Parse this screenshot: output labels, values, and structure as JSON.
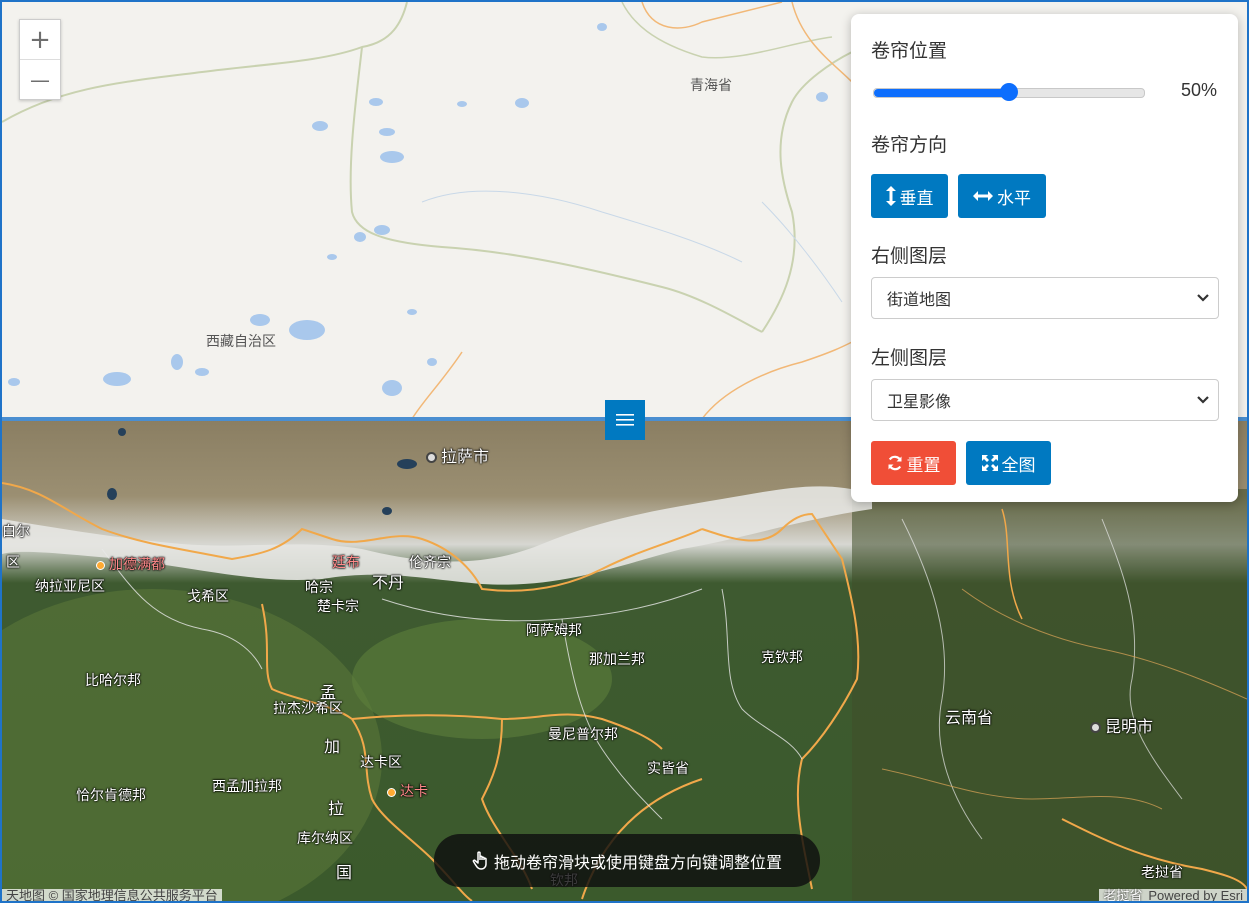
{
  "top_map": {
    "labels": {
      "qinghai": "青海省",
      "xizang": "西藏自治区"
    }
  },
  "bottom_map": {
    "labels": {
      "lhasa": "拉萨市",
      "kathmandu": "加德满都",
      "thimphu": "廷布",
      "bhutan": "不丹",
      "lhuntse": "伦齐宗",
      "haa": "哈宗",
      "chukha": "楚卡宗",
      "narayani": "纳拉亚尼区",
      "gandaki": "戈希区",
      "bihar": "比哈尔邦",
      "assam": "阿萨姆邦",
      "nagaland": "那加兰邦",
      "kachin": "克钦邦",
      "manipur": "曼尼普尔邦",
      "chin": "实皆省",
      "rajshahi": "拉杰沙希区",
      "dhaka_div": "达卡区",
      "dhaka": "达卡",
      "west_bengal": "西孟加拉邦",
      "jharkhand": "恰尔肯德邦",
      "khulna": "库尔纳区",
      "bangladesh_1": "孟",
      "bangladesh_2": "加",
      "bangladesh_3": "拉",
      "bangladesh_4": "国",
      "yunnan": "云南省",
      "kunming": "昆明市",
      "laos": "老挝省",
      "left_edge_1": "白尔",
      "left_edge_2": "区",
      "shan": "钦邦"
    }
  },
  "zoom": {
    "in": "+",
    "out": "—"
  },
  "panel": {
    "position_title": "卷帘位置",
    "position_value": 50,
    "position_text": "50%",
    "direction_title": "卷帘方向",
    "vertical_label": "垂直",
    "horizontal_label": "水平",
    "right_layer_title": "右侧图层",
    "right_layer_value": "街道地图",
    "left_layer_title": "左侧图层",
    "left_layer_value": "卫星影像",
    "reset_label": "重置",
    "full_label": "全图"
  },
  "hint": "拖动卷帘滑块或使用键盘方向键调整位置",
  "attribution": {
    "left": "天地图 © 国家地理信息公共服务平台",
    "right": "Powered by Esri",
    "right_partial": "老挝省"
  },
  "colors": {
    "accent": "#0079c1",
    "danger": "#f04e37",
    "slider": "#0d6efd"
  }
}
